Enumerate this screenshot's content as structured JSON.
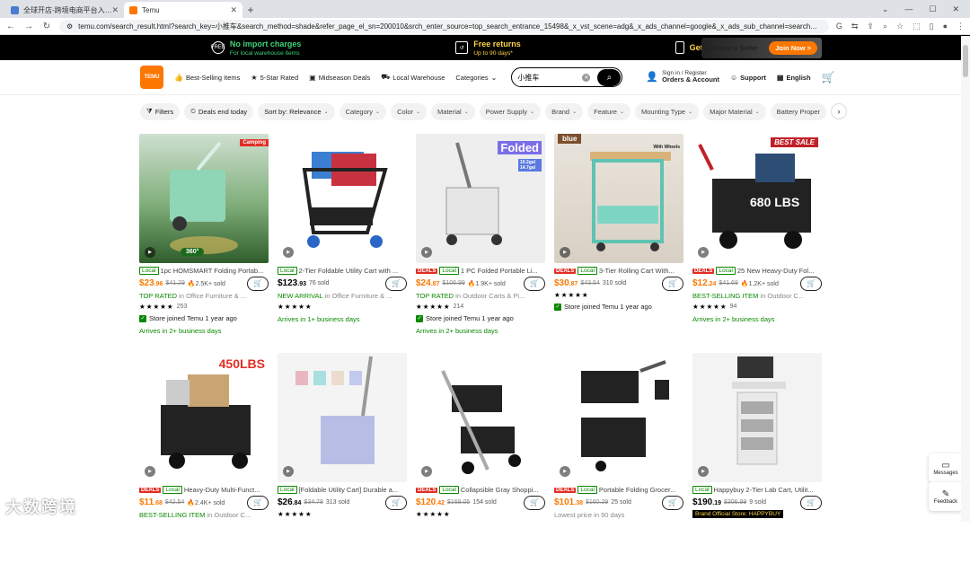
{
  "browser": {
    "tabs": [
      {
        "title": "全球开店-跨境电商平台入驻入口",
        "active": false
      },
      {
        "title": "Temu",
        "active": true
      }
    ],
    "url": "temu.com/search_result.html?search_key=小推车&search_method=shade&refer_page_el_sn=200010&srch_enter_source=top_search_entrance_15498&_x_vst_scene=adg&_x_ads_channel=google&_x_ads_sub_channel=search&_x..."
  },
  "promo": {
    "items": [
      {
        "title": "No import charges",
        "sub": "For local warehouse items"
      },
      {
        "title": "Free returns",
        "sub": "Up to 90 days*"
      },
      {
        "title": "Get the Temu App",
        "sub": ""
      }
    ],
    "seller_label": "Become a Seller",
    "join_label": "Join Now >"
  },
  "header": {
    "logo_text": "TEMU",
    "nav": [
      "Best-Selling Items",
      "5-Star Rated",
      "Midseason Deals",
      "Local Warehouse",
      "Categories"
    ],
    "search_value": "小推车",
    "sign_in": "Sign in / Register",
    "orders": "Orders & Account",
    "support": "Support",
    "language": "English"
  },
  "filters": [
    "Filters",
    "Deals end today",
    "Sort by: Relevance",
    "Category",
    "Color",
    "Material",
    "Power Supply",
    "Brand",
    "Feature",
    "Mounting Type",
    "Major Material",
    "Battery Proper"
  ],
  "products": [
    {
      "deal": false,
      "title": "1pc HOMSMART Folding Portab...",
      "price": "$23",
      "cents": ".96",
      "orig": "$41.29",
      "sold": "2.5K+ sold",
      "line1_hl": "TOP RATED",
      "line1_rest": " in Office Furniture & ...",
      "stars": "★★★★★",
      "count": "253",
      "store": "Store joined Temu 1 year ago",
      "arrive": "Arrives in 2+ business days",
      "tag": "Camping",
      "label": "360°"
    },
    {
      "deal": false,
      "title": "2-Tier Foldable Utility Cart with ...",
      "price": "$123",
      "cents": ".93",
      "orig": "",
      "sold": "76 sold",
      "line1_hl": "NEW ARRIVAL",
      "line1_rest": " in Office Furniture & ...",
      "stars": "★★★★★",
      "count": "",
      "store": "",
      "arrive": "Arrives in 1+ business days",
      "tag": "",
      "label": ""
    },
    {
      "deal": true,
      "title": "1 PC Folded Portable Li...",
      "price": "$24",
      "cents": ".87",
      "orig": "$106.99",
      "sold": "1.9K+ sold",
      "line1_hl": "TOP RATED",
      "line1_rest": " in Outdoor Carts & Pi...",
      "stars": "★★★★★",
      "count": "214",
      "store": "Store joined Temu 1 year ago",
      "arrive": "Arrives in 2+ business days",
      "tag": "Folded",
      "label": "10.2gal 14.7gal"
    },
    {
      "deal": true,
      "title": "3-Tier Rolling Cart With...",
      "price": "$30",
      "cents": ".87",
      "orig": "$43.54",
      "sold": "310 sold",
      "line1_hl": "",
      "line1_rest": "",
      "stars": "★★★★★",
      "count": "",
      "store": "Store joined Temu 1 year ago",
      "arrive": "",
      "tag": "blue",
      "label": "With Wheels"
    },
    {
      "deal": true,
      "title": "25 New Heavy-Duty Fol...",
      "price": "$12",
      "cents": ".24",
      "orig": "$41.69",
      "sold": "1.2K+ sold",
      "line1_hl": "BEST-SELLING ITEM",
      "line1_rest": " in Outdoor C...",
      "stars": "★★★★★",
      "count": "94",
      "store": "",
      "arrive": "Arrives in 2+ business days",
      "tag": "BEST SALE",
      "label": "680 LBS"
    },
    {
      "deal": true,
      "title": "Heavy-Duty Multi-Funct...",
      "price": "$11",
      "cents": ".68",
      "orig": "$42.54",
      "sold": "2.4K+ sold",
      "line1_hl": "BEST-SELLING ITEM",
      "line1_rest": " in Outdoor C...",
      "stars": "",
      "count": "",
      "store": "",
      "arrive": "",
      "tag": "450LBS",
      "label": ""
    },
    {
      "deal": false,
      "title": "[Foldable Utility Cart] Durable a...",
      "price": "$26",
      "cents": ".84",
      "orig": "$34.78",
      "sold": "313 sold",
      "line1_hl": "",
      "line1_rest": "",
      "stars": "★★★★★",
      "count": "",
      "store": "",
      "arrive": "",
      "tag": "",
      "label": ""
    },
    {
      "deal": true,
      "title": "Collapsible Gray Shoppi...",
      "price": "$120",
      "cents": ".42",
      "orig": "$169.05",
      "sold": "154 sold",
      "line1_hl": "",
      "line1_rest": "",
      "stars": "★★★★★",
      "count": "",
      "store": "",
      "arrive": "",
      "tag": "",
      "label": ""
    },
    {
      "deal": true,
      "title": "Portable Folding Grocer...",
      "price": "$101",
      "cents": ".38",
      "orig": "$160.29",
      "sold": "25 sold",
      "line1_hl": "",
      "line1_rest": "Lowest price in 90 days",
      "stars": "",
      "count": "",
      "store": "",
      "arrive": "",
      "tag": "",
      "label": ""
    },
    {
      "deal": false,
      "title": "Happybuy 2-Tier Lab Cart, Utilit...",
      "price": "$190",
      "cents": ".19",
      "orig": "$306.99",
      "sold": "9 sold",
      "line1_hl": "",
      "line1_rest": "",
      "stars": "",
      "count": "",
      "store": "Brand Official Store: HAPPYBUY",
      "arrive": "",
      "tag": "",
      "label": ""
    }
  ],
  "badges": {
    "deal": "DEALS",
    "local": "Local"
  },
  "side": {
    "messages": "Messages",
    "feedback": "Feedback"
  },
  "watermark": "大数跨境",
  "colors": {
    "accent": "#fb7701",
    "green": "#0a8800",
    "deal": "#e02e24"
  }
}
